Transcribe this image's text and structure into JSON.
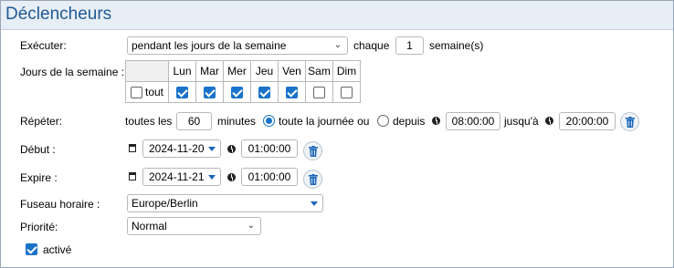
{
  "section": {
    "title": "Déclencheurs"
  },
  "execute": {
    "label": "Exécuter:",
    "mode": "pendant les jours de la semaine",
    "every_label": "chaque",
    "every_value": "1",
    "unit": "semaine(s)"
  },
  "weekdays": {
    "label": "Jours de la semaine :",
    "all_label": "tout",
    "all_checked": false,
    "days": [
      {
        "name": "Lun",
        "checked": true
      },
      {
        "name": "Mar",
        "checked": true
      },
      {
        "name": "Mer",
        "checked": true
      },
      {
        "name": "Jeu",
        "checked": true
      },
      {
        "name": "Ven",
        "checked": true
      },
      {
        "name": "Sam",
        "checked": false
      },
      {
        "name": "Dim",
        "checked": false
      }
    ]
  },
  "repeat": {
    "label": "Répéter:",
    "every_label": "toutes les",
    "interval": "60",
    "minutes_label": "minutes",
    "allday_label": "toute la journée ou",
    "allday_selected": true,
    "since_label": "depuis",
    "since_selected": false,
    "from_time": "08:00:00",
    "until_label": "jusqu'à",
    "to_time": "20:00:00"
  },
  "start": {
    "label": "Début :",
    "date": "2024-11-20",
    "time": "01:00:00"
  },
  "expires": {
    "label": "Expire :",
    "date": "2024-11-21",
    "time": "01:00:00"
  },
  "timezone": {
    "label": "Fuseau horaire :",
    "value": "Europe/Berlin"
  },
  "priority": {
    "label": "Priorité:",
    "value": "Normal"
  },
  "enabled": {
    "label": "activé",
    "checked": true
  },
  "colors": {
    "accent": "#1a73c9",
    "title": "#1f5a96",
    "header_bg": "#e8eef5"
  },
  "icons": [
    "chevron-down-icon",
    "clock-icon",
    "calendar-icon",
    "trash-icon",
    "checkbox-icon",
    "radio-icon"
  ]
}
